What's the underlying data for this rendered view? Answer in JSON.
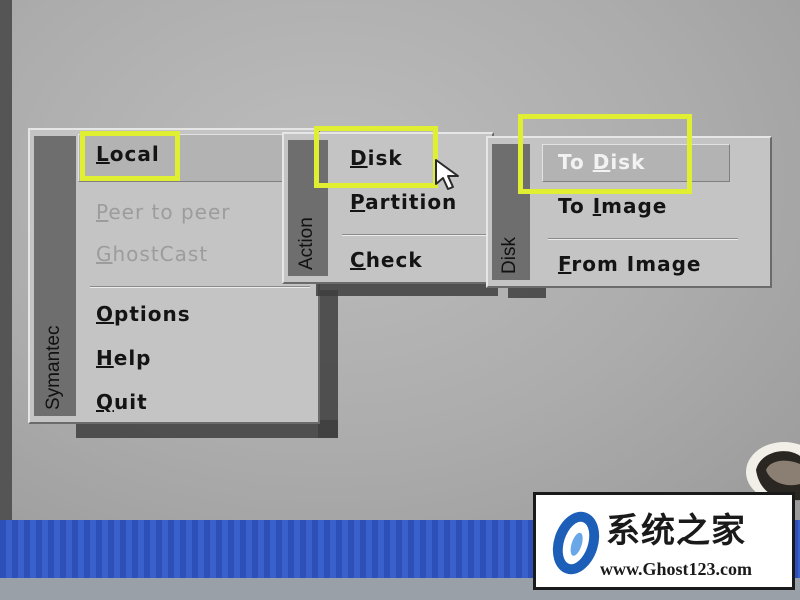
{
  "menus": {
    "main": {
      "side_label": "Symantec",
      "items": [
        {
          "mnemonic": "L",
          "rest": "ocal",
          "enabled": true,
          "selected": true
        },
        {
          "mnemonic": "P",
          "rest": "eer to peer",
          "enabled": false
        },
        {
          "mnemonic": "G",
          "rest": "hostCast",
          "enabled": false
        },
        {
          "mnemonic": "O",
          "rest": "ptions",
          "enabled": true
        },
        {
          "mnemonic": "H",
          "rest": "elp",
          "enabled": true
        },
        {
          "mnemonic": "Q",
          "rest": "uit",
          "enabled": true
        }
      ]
    },
    "action": {
      "side_label": "Action",
      "items": [
        {
          "mnemonic": "D",
          "rest": "isk",
          "enabled": true,
          "selected": true
        },
        {
          "mnemonic": "P",
          "rest": "artition",
          "enabled": true
        },
        {
          "mnemonic": "C",
          "rest": "heck",
          "enabled": true
        }
      ]
    },
    "disk": {
      "side_label": "Disk",
      "items": [
        {
          "prefix": "To ",
          "mnemonic": "D",
          "rest": "isk",
          "enabled": true,
          "selected": true
        },
        {
          "prefix": "To ",
          "mnemonic": "I",
          "rest": "mage",
          "enabled": true
        },
        {
          "prefix": "",
          "mnemonic": "F",
          "rest": "rom Image",
          "enabled": true
        }
      ]
    }
  },
  "highlight_color": "#e1ef33",
  "cursor_icon": "arrow-pointer-icon",
  "watermark": {
    "title": "系统之家",
    "url": "www.Ghost123.com"
  }
}
